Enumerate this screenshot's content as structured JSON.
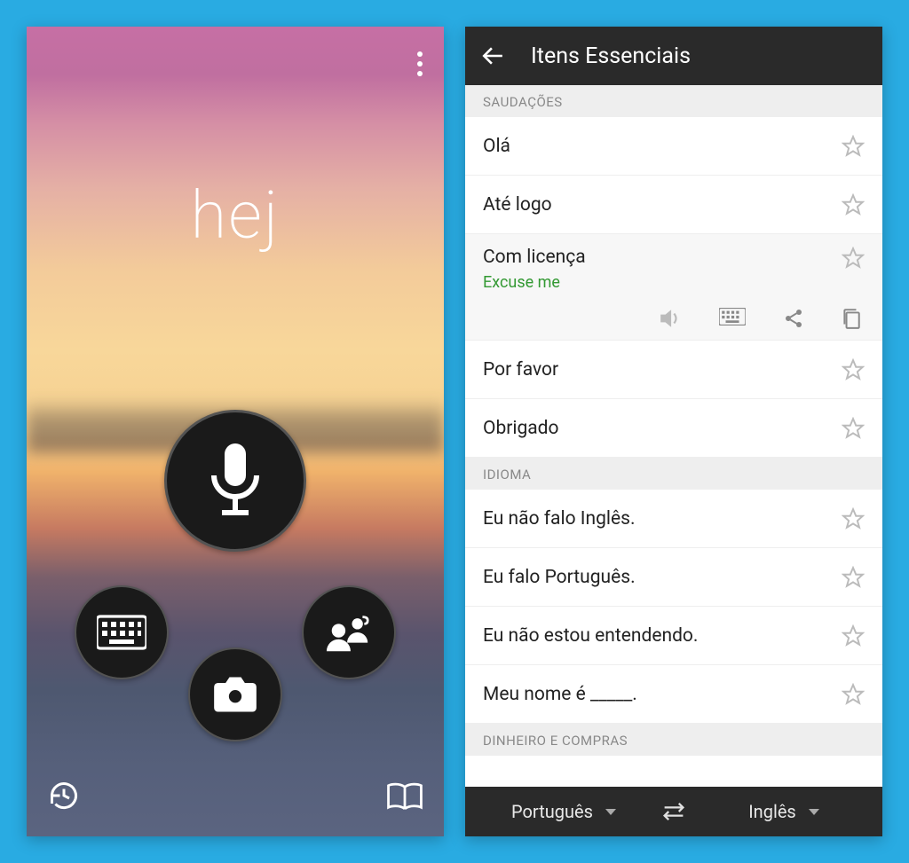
{
  "left": {
    "word": "hej"
  },
  "right": {
    "appbar_title": "Itens Essenciais",
    "section_greetings": "SAUDAÇÕES",
    "section_language": "IDIOMA",
    "section_money": "DINHEIRO E COMPRAS",
    "items_greetings": [
      {
        "label": "Olá"
      },
      {
        "label": "Até logo"
      },
      {
        "label": "Com licença",
        "translation": "Excuse me",
        "expanded": true
      },
      {
        "label": "Por favor"
      },
      {
        "label": "Obrigado"
      }
    ],
    "items_language": [
      {
        "label": "Eu não falo Inglês."
      },
      {
        "label": "Eu falo Português."
      },
      {
        "label": "Eu não estou entendendo."
      },
      {
        "label": "Meu nome é _____."
      }
    ],
    "source_lang": "Português",
    "target_lang": "Inglês"
  }
}
